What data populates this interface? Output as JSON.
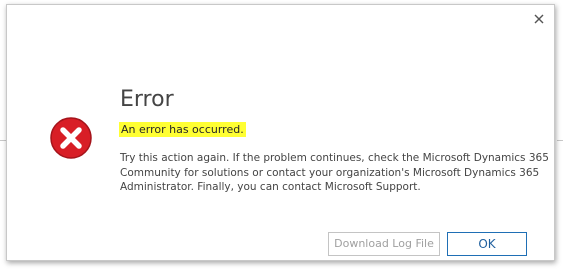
{
  "dialog": {
    "title": "Error",
    "subtitle": "An error has occurred.",
    "message": "Try this action again. If the problem continues, check the Microsoft Dynamics 365 Community for solutions or contact your organization's Microsoft Dynamics 365 Administrator. Finally, you can contact Microsoft Support.",
    "icon": "error-circle-x",
    "close_icon": "close-x"
  },
  "buttons": {
    "download_log": "Download Log File",
    "ok": "OK"
  },
  "colors": {
    "error_red": "#d81e26",
    "highlight": "#ffff33",
    "accent_blue": "#1f6fb5"
  }
}
